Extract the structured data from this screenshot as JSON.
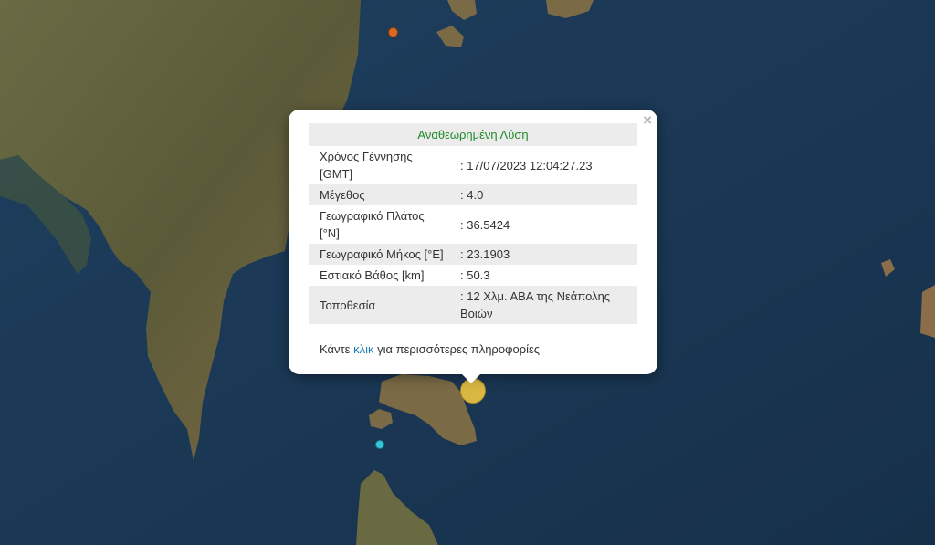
{
  "popup": {
    "title": "Αναθεωρημένη Λύση",
    "close_symbol": "×",
    "rows": [
      {
        "label": "Χρόνος Γέννησης [GMT]",
        "value": ": 17/07/2023 12:04:27.23"
      },
      {
        "label": "Μέγεθος",
        "value": ": 4.0"
      },
      {
        "label": "Γεωγραφικό Πλάτος [°N]",
        "value": ": 36.5424"
      },
      {
        "label": "Γεωγραφικό Μήκος [°E]",
        "value": ": 23.1903"
      },
      {
        "label": "Εστιακό Βάθος [km]",
        "value": ": 50.3"
      },
      {
        "label": "Τοποθεσία",
        "value": ": 12 Χλμ. ΑΒΑ της Νεάπολης Βοιών"
      }
    ],
    "more_prefix": "Κάντε ",
    "more_link": "κλικ",
    "more_suffix": " για περισσότερες πληροφορίες"
  },
  "colors": {
    "sea": "#1c3a57",
    "land": "#5a5a3a",
    "title": "#1f8a29",
    "link": "#1d7fb6",
    "marker_main": "#e3bf43",
    "marker_orange": "#d86a22",
    "marker_cyan": "#35c5d8"
  }
}
